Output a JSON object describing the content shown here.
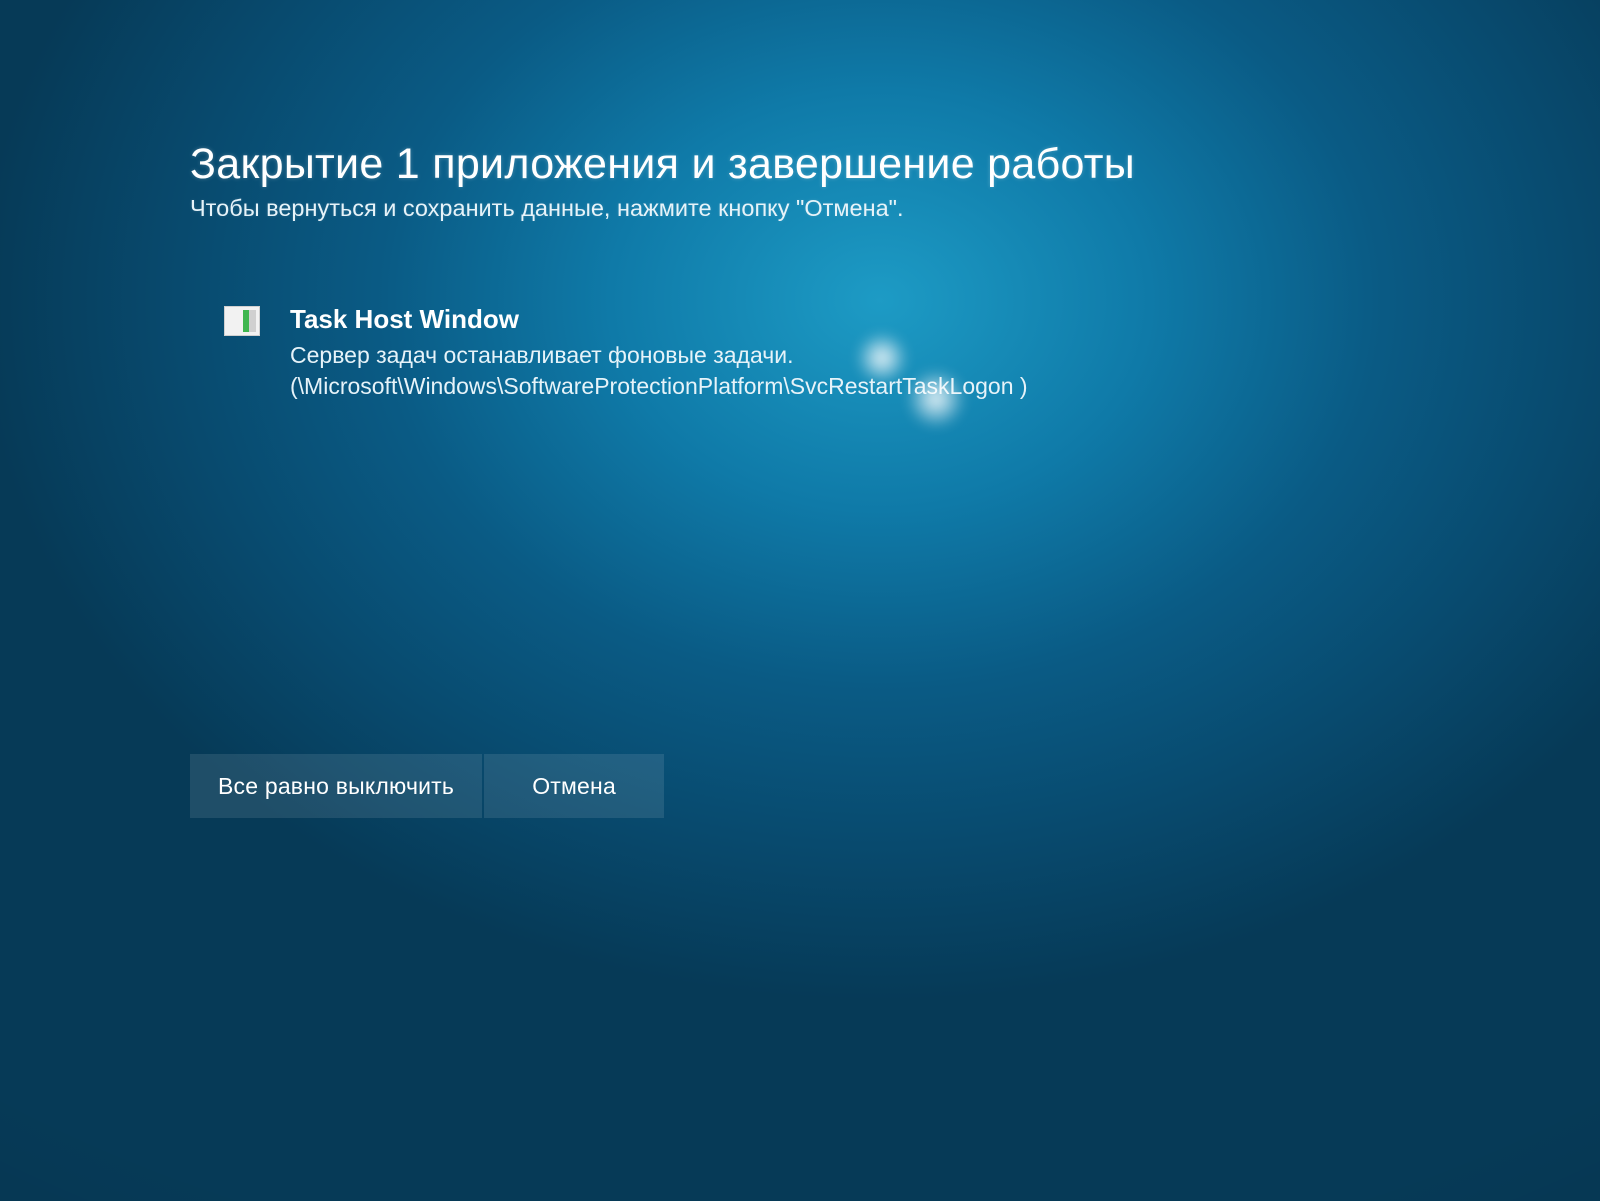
{
  "header": {
    "title": "Закрытие 1 приложения и завершение работы",
    "subtitle": "Чтобы вернуться и сохранить данные, нажмите кнопку \"Отмена\"."
  },
  "app": {
    "name": "Task Host Window",
    "detail": "Сервер задач останавливает фоновые задачи. (\\Microsoft\\Windows\\SoftwareProtectionPlatform\\SvcRestartTaskLogon )",
    "icon": "generic-app-icon"
  },
  "buttons": {
    "shutdown_anyway": "Все равно выключить",
    "cancel": "Отмена"
  }
}
